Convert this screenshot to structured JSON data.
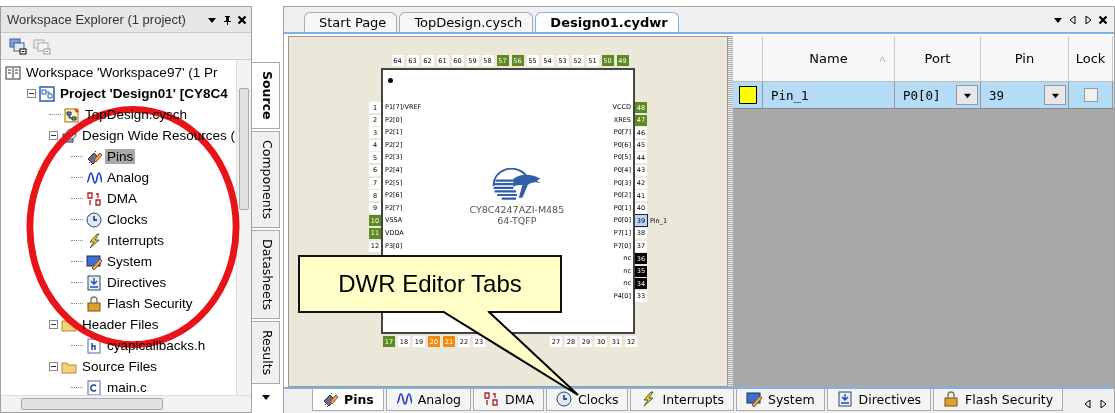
{
  "explorer": {
    "title": "Workspace Explorer (1 project)",
    "tree": [
      {
        "label": "Workspace 'Workspace97' (1 Pr",
        "kind": "workspace",
        "selected": false,
        "children": [
          {
            "label": "Project  'Design01' [CY8C4",
            "kind": "project",
            "selected": false,
            "expanded": true,
            "children": [
              {
                "label": "TopDesign.cysch",
                "kind": "schematic",
                "selected": false
              },
              {
                "label": "Design Wide Resources (",
                "kind": "dwr",
                "selected": false,
                "expanded": true,
                "children": [
                  {
                    "label": "Pins",
                    "kind": "pins",
                    "selected": true
                  },
                  {
                    "label": "Analog",
                    "kind": "analog",
                    "selected": false
                  },
                  {
                    "label": "DMA",
                    "kind": "dma",
                    "selected": false
                  },
                  {
                    "label": "Clocks",
                    "kind": "clocks",
                    "selected": false
                  },
                  {
                    "label": "Interrupts",
                    "kind": "interrupts",
                    "selected": false
                  },
                  {
                    "label": "System",
                    "kind": "system",
                    "selected": false
                  },
                  {
                    "label": "Directives",
                    "kind": "directives",
                    "selected": false
                  },
                  {
                    "label": "Flash Security",
                    "kind": "flash",
                    "selected": false
                  }
                ]
              },
              {
                "label": "Header Files",
                "kind": "folder",
                "selected": false,
                "expanded": true,
                "children": [
                  {
                    "label": "cyapicallbacks.h",
                    "kind": "hfile",
                    "selected": false
                  }
                ]
              },
              {
                "label": "Source Files",
                "kind": "folder",
                "selected": false,
                "expanded": true,
                "children": [
                  {
                    "label": "main.c",
                    "kind": "cfile",
                    "selected": false
                  }
                ]
              }
            ]
          }
        ]
      }
    ]
  },
  "side_tabs": [
    {
      "label": "Source",
      "selected": true
    },
    {
      "label": "Components",
      "selected": false
    },
    {
      "label": "Datasheets",
      "selected": false
    },
    {
      "label": "Results",
      "selected": false
    }
  ],
  "editor_tabs": [
    {
      "label": "Start Page",
      "selected": false
    },
    {
      "label": "TopDesign.cysch",
      "selected": false
    },
    {
      "label": "Design01.cydwr",
      "selected": true
    }
  ],
  "chip": {
    "part": "CY8C4247AZI-M485",
    "package": "64-TQFP",
    "top_pins": [
      {
        "number": "64",
        "kind": "free"
      },
      {
        "number": "63",
        "kind": "free"
      },
      {
        "number": "62",
        "kind": "free"
      },
      {
        "number": "61",
        "kind": "free"
      },
      {
        "number": "60",
        "kind": "free"
      },
      {
        "number": "59",
        "kind": "free"
      },
      {
        "number": "58",
        "kind": "free"
      },
      {
        "number": "57",
        "kind": "power"
      },
      {
        "number": "56",
        "kind": "power"
      },
      {
        "number": "55",
        "kind": "free"
      },
      {
        "number": "54",
        "kind": "free"
      },
      {
        "number": "53",
        "kind": "free"
      },
      {
        "number": "52",
        "kind": "free"
      },
      {
        "number": "51",
        "kind": "free"
      },
      {
        "number": "50",
        "kind": "power"
      },
      {
        "number": "49",
        "kind": "power"
      }
    ],
    "left_pins": [
      {
        "number": "1",
        "label": "P1[7]/VREF",
        "kind": "free"
      },
      {
        "number": "2",
        "label": "P2[0]",
        "kind": "free"
      },
      {
        "number": "3",
        "label": "P2[1]",
        "kind": "free"
      },
      {
        "number": "4",
        "label": "P2[2]",
        "kind": "free"
      },
      {
        "number": "5",
        "label": "P2[3]",
        "kind": "free"
      },
      {
        "number": "6",
        "label": "P2[4]",
        "kind": "free"
      },
      {
        "number": "7",
        "label": "P2[5]",
        "kind": "free"
      },
      {
        "number": "8",
        "label": "P2[6]",
        "kind": "free"
      },
      {
        "number": "9",
        "label": "P2[7]",
        "kind": "free"
      },
      {
        "number": "10",
        "label": "VSSA",
        "kind": "power"
      },
      {
        "number": "11",
        "label": "VDDA",
        "kind": "power"
      },
      {
        "number": "12",
        "label": "P3[0]",
        "kind": "free"
      }
    ],
    "right_pins": [
      {
        "number": "48",
        "label": "VCCD",
        "kind": "power"
      },
      {
        "number": "47",
        "label": "XRES",
        "kind": "power"
      },
      {
        "number": "46",
        "label": "P0[7]",
        "kind": "free"
      },
      {
        "number": "45",
        "label": "P0[6]",
        "kind": "free"
      },
      {
        "number": "44",
        "label": "P0[5]",
        "kind": "free"
      },
      {
        "number": "43",
        "label": "P0[4]",
        "kind": "free"
      },
      {
        "number": "42",
        "label": "P0[3]",
        "kind": "free"
      },
      {
        "number": "41",
        "label": "P0[2]",
        "kind": "free"
      },
      {
        "number": "40",
        "label": "P0[1]",
        "kind": "free"
      },
      {
        "number": "39",
        "label": "P0[0]",
        "kind": "used",
        "assigned": "Pin_1"
      },
      {
        "number": "38",
        "label": "P7[1]",
        "kind": "free"
      },
      {
        "number": "37",
        "label": "P7[0]",
        "kind": "free"
      },
      {
        "number": "36",
        "label": "nc",
        "kind": "nc"
      },
      {
        "number": "35",
        "label": "nc",
        "kind": "nc"
      },
      {
        "number": "34",
        "label": "nc",
        "kind": "nc"
      },
      {
        "number": "33",
        "label": "P4[0]",
        "kind": "free"
      }
    ],
    "bottom_pins": [
      {
        "number": "17",
        "kind": "power"
      },
      {
        "number": "18",
        "kind": "free"
      },
      {
        "number": "19",
        "kind": "free"
      },
      {
        "number": "20",
        "kind": "fixed"
      },
      {
        "number": "21",
        "kind": "fixed"
      },
      {
        "number": "22",
        "kind": "free"
      },
      {
        "number": "23",
        "kind": "free"
      }
    ],
    "bottom_pins_right": [
      {
        "number": "27",
        "kind": "free"
      },
      {
        "number": "28",
        "kind": "free"
      },
      {
        "number": "29",
        "kind": "free"
      },
      {
        "number": "30",
        "kind": "free"
      },
      {
        "number": "31",
        "kind": "free"
      },
      {
        "number": "32",
        "kind": "free"
      }
    ]
  },
  "callout": {
    "text": "DWR Editor Tabs"
  },
  "pin_table": {
    "columns": [
      "Name",
      "Port",
      "Pin",
      "Lock"
    ],
    "rows": [
      {
        "color": "#ffff00",
        "name": "Pin_1",
        "port": "P0[0]",
        "pin": "39",
        "locked": false,
        "selected": true
      }
    ]
  },
  "bottom_tabs": [
    {
      "label": "Pins",
      "kind": "pins",
      "selected": true
    },
    {
      "label": "Analog",
      "kind": "analog",
      "selected": false
    },
    {
      "label": "DMA",
      "kind": "dma",
      "selected": false
    },
    {
      "label": "Clocks",
      "kind": "clocks",
      "selected": false
    },
    {
      "label": "Interrupts",
      "kind": "interrupts",
      "selected": false
    },
    {
      "label": "System",
      "kind": "system",
      "selected": false
    },
    {
      "label": "Directives",
      "kind": "directives",
      "selected": false
    },
    {
      "label": "Flash Security",
      "kind": "flash",
      "selected": false
    }
  ]
}
